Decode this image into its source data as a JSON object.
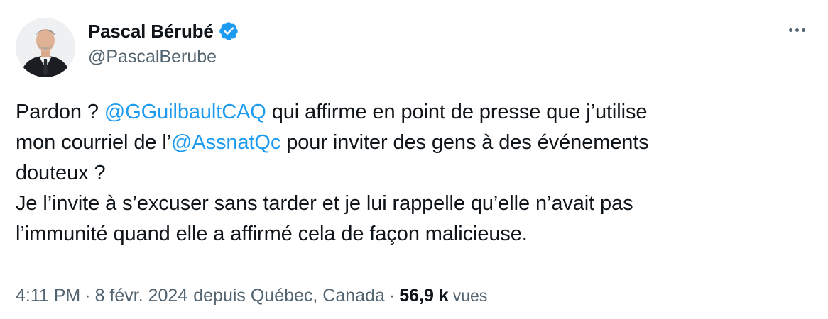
{
  "author": {
    "name": "Pascal Bérubé",
    "handle": "@PascalBerube",
    "verified": true,
    "verified_color": "#1d9bf0"
  },
  "menu": {
    "more_icon": "more-horizontal-icon"
  },
  "tweet": {
    "line1": {
      "pre": "Pardon ? ",
      "mention": "@GGuilbaultCAQ",
      "post": " qui affirme en point de presse que j’utilise"
    },
    "line2": {
      "pre": "mon courriel de l’",
      "mention": "@AssnatQc",
      "post": " pour inviter des gens à des événements"
    },
    "line3": "douteux ?",
    "line4": "Je l’invite à s’excuser sans tarder et je lui rappelle qu’elle n’avait pas",
    "line5": "l’immunité quand elle a affirmé cela de façon malicieuse."
  },
  "meta": {
    "time": "4:11 PM",
    "separator": "·",
    "date": "8 févr. 2024",
    "location": "depuis Québec, Canada",
    "views_count": "56,9 k",
    "views_label": "vues"
  },
  "colors": {
    "link": "#1d9bf0",
    "text": "#0f1419",
    "secondary": "#536471"
  }
}
